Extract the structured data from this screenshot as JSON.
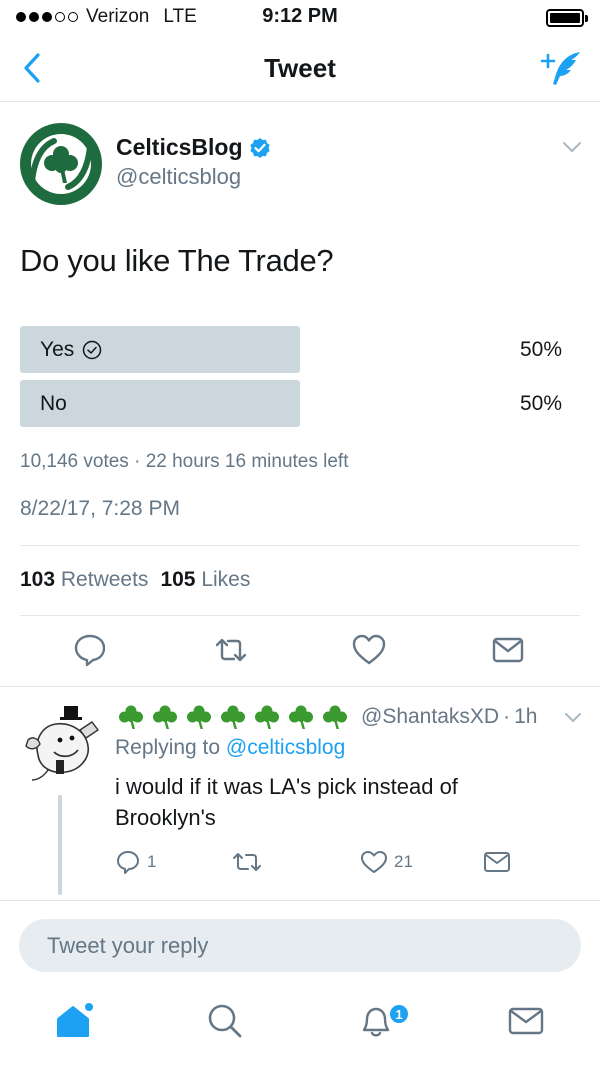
{
  "status_bar": {
    "carrier": "Verizon",
    "network": "LTE",
    "time": "9:12 PM"
  },
  "nav": {
    "title": "Tweet"
  },
  "tweet": {
    "author_name": "CelticsBlog",
    "author_handle": "@celticsblog",
    "text": "Do you like The Trade?",
    "poll": {
      "options": [
        {
          "label": "Yes",
          "percent_label": "50%",
          "fraction": 0.5,
          "selected": true
        },
        {
          "label": "No",
          "percent_label": "50%",
          "fraction": 0.5,
          "selected": false
        }
      ],
      "votes": "10,146 votes",
      "separator": "·",
      "time_left": "22 hours 16 minutes left"
    },
    "timestamp": "8/22/17, 7:28 PM",
    "retweets_count": "103",
    "retweets_label": "Retweets",
    "likes_count": "105",
    "likes_label": "Likes"
  },
  "reply": {
    "clover_count": 7,
    "handle": "@ShantaksXD",
    "separator": "·",
    "time": "1h",
    "replying_prefix": "Replying to",
    "replying_to": "@celticsblog",
    "text": "i would if it was LA's pick instead of Brooklyn's",
    "reply_count": "1",
    "like_count": "21"
  },
  "composer": {
    "placeholder": "Tweet your reply"
  },
  "tabbar": {
    "notification_badge": "1"
  },
  "colors": {
    "accent": "#1da1f2",
    "poll_bar": "#ccd6dd",
    "muted": "#657786",
    "celtics_green": "#1e6b3f"
  },
  "icons": [
    "back-chevron-icon",
    "compose-tweet-icon",
    "verified-badge-icon",
    "chevron-down-icon",
    "check-circle-icon",
    "reply-icon",
    "retweet-icon",
    "heart-icon",
    "direct-message-icon",
    "shamrock-icon",
    "home-icon",
    "search-icon",
    "notifications-bell-icon",
    "messages-icon"
  ]
}
